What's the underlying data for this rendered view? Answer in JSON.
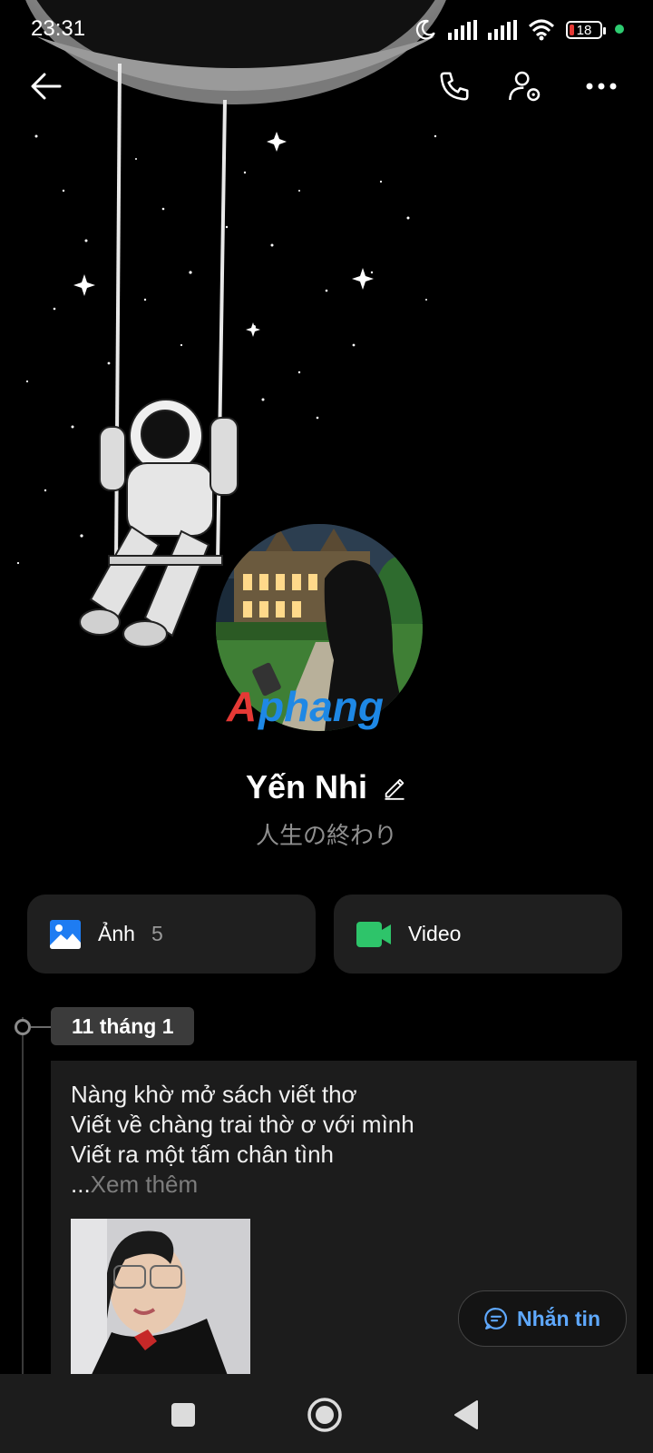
{
  "status_bar": {
    "time": "23:31",
    "battery": "18",
    "colors": {
      "battery_low": "#e53935",
      "online_dot": "#2ecc71"
    }
  },
  "top_bar": {
    "icons": [
      "arrow-left-icon",
      "phone-icon",
      "user-settings-icon",
      "more-icon"
    ]
  },
  "profile": {
    "name": "Yến Nhi",
    "status": "人生の終わり",
    "watermark": "Aphang"
  },
  "media": {
    "photos_label": "Ảnh",
    "photos_count": "5",
    "video_label": "Video",
    "colors": {
      "photos_icon": "#1e7cf2",
      "video_icon": "#2ec46a"
    }
  },
  "timeline": {
    "date": "11 tháng 1",
    "post": {
      "lines": [
        "Nàng khờ mở sách viết thơ",
        "Viết về chàng trai thờ ơ với mình",
        "Viết ra một tấm chân tình"
      ],
      "ellipsis": "...",
      "see_more": "Xem thêm"
    }
  },
  "message_button": {
    "label": "Nhắn tin",
    "color": "#5fa9ff"
  },
  "navbar": {
    "icons": [
      "square-icon",
      "home-circle-icon",
      "back-triangle-icon"
    ]
  }
}
